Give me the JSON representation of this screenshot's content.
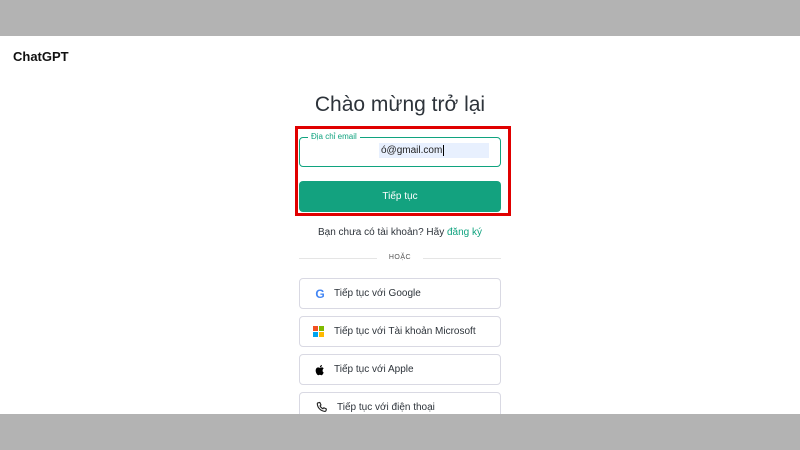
{
  "brand": "ChatGPT",
  "title": "Chào mừng trở lại",
  "email": {
    "label": "Địa chỉ email",
    "value": "ó@gmail.com"
  },
  "continue_button": "Tiếp tục",
  "signup": {
    "prompt": "Bạn chưa có tài khoản? Hãy",
    "link": "đăng ký"
  },
  "divider_text": "HOẶC",
  "social": [
    {
      "label": "Tiếp tục với Google",
      "icon": "google-icon"
    },
    {
      "label": "Tiếp tục với Tài khoản Microsoft",
      "icon": "microsoft-icon"
    },
    {
      "label": "Tiếp tục với Apple",
      "icon": "apple-icon"
    },
    {
      "label": "Tiếp tục với điện thoại",
      "icon": "phone-icon"
    }
  ],
  "colors": {
    "accent": "#10a37f",
    "highlight": "#e00000"
  }
}
